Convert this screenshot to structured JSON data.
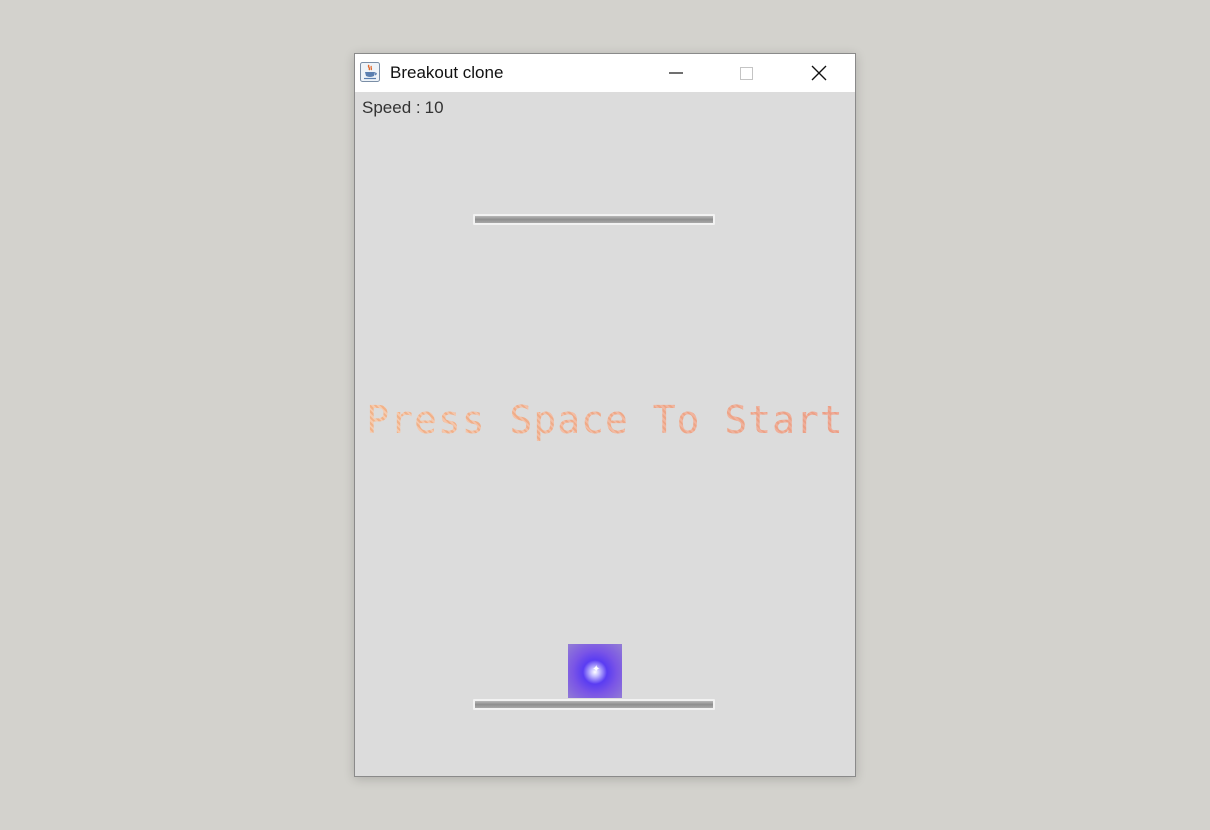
{
  "window": {
    "title": "Breakout clone",
    "icon": "java-cup-icon",
    "controls": {
      "minimize": "minimize-icon",
      "maximize": "maximize-icon",
      "close": "close-icon"
    }
  },
  "hud": {
    "speed_label": "Speed :",
    "speed_value": "10"
  },
  "game": {
    "start_message": "Press Space To Start",
    "ball_icon": "ball-sprite-icon"
  },
  "colors": {
    "background": "#dcdcdc",
    "paddle": "#a0a0a0",
    "message_warm": "#f2b48a",
    "message_rose": "#e68c82",
    "ball": "#5a3cf2"
  }
}
